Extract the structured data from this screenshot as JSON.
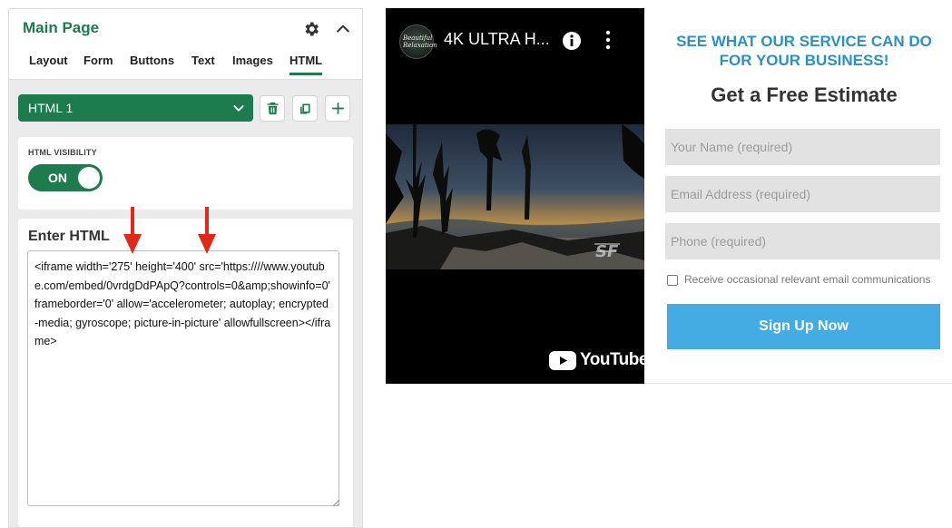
{
  "panel": {
    "title": "Main Page",
    "tabs": [
      "Layout",
      "Form",
      "Buttons",
      "Text",
      "Images",
      "HTML"
    ],
    "active_tab": "HTML",
    "selector_label": "HTML 1",
    "visibility": {
      "label": "HTML VISIBILITY",
      "state": "ON"
    },
    "html_editor": {
      "title": "Enter HTML",
      "code": "<iframe width='275' height='400' src='https:////www.youtube.com/embed/0vrdgDdPApQ?controls=0&amp;showinfo=0' frameborder='0' allow='accelerometer; autoplay; encrypted-media; gyroscope; picture-in-picture' allowfullscreen></iframe>"
    }
  },
  "video": {
    "channel_logo_text": "Beautiful Relaxation",
    "title": "4K ULTRA H...",
    "watermark": "SF",
    "platform": "YouTube"
  },
  "form": {
    "heading": "SEE WHAT OUR SERVICE CAN DO FOR YOUR BUSINESS!",
    "subheading": "Get a Free Estimate",
    "name_placeholder": "Your Name (required)",
    "email_placeholder": "Email Address (required)",
    "phone_placeholder": "Phone (required)",
    "consent_label": "Receive occasional relevant email communications",
    "submit_label": "Sign Up Now"
  },
  "colors": {
    "brand_green": "#1e7b4d",
    "form_blue": "#2a91c6",
    "button_blue": "#44ace2",
    "annotation_red": "#e0291a"
  },
  "icons": [
    "gear-icon",
    "chevron-up-icon",
    "chevron-down-icon",
    "trash-icon",
    "copy-icon",
    "plus-icon",
    "info-icon",
    "more-vertical-icon",
    "youtube-play-icon",
    "arrow-down-icon"
  ]
}
